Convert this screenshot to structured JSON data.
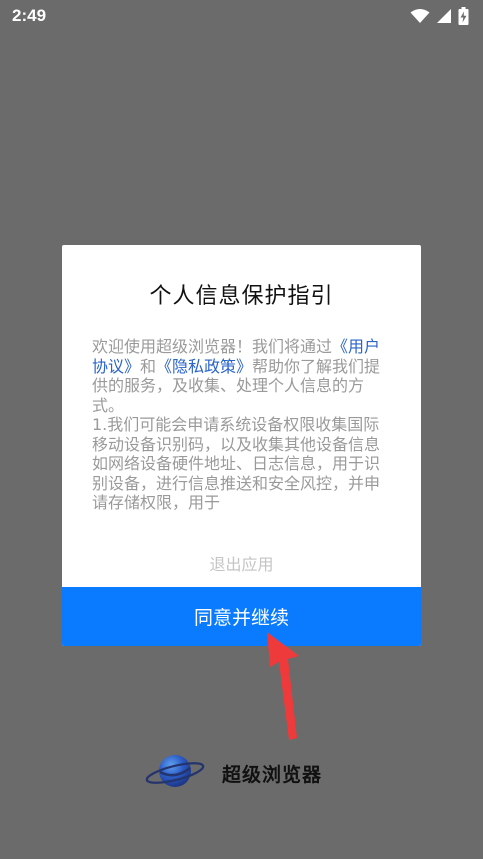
{
  "status_bar": {
    "time": "2:49",
    "icons": [
      "wifi-icon",
      "signal-icon",
      "battery-charging-icon"
    ]
  },
  "dialog": {
    "title": "个人信息保护指引",
    "paragraph1": {
      "prefix": "欢迎使用超级浏览器！我们将通过",
      "link_user_agreement": "《用户协议》",
      "middle": "和",
      "link_privacy_policy": "《隐私政策》",
      "suffix": "帮助你了解我们提供的服务，及收集、处理个人信息的方式。"
    },
    "paragraph2": "1.我们可能会申请系统设备权限收集国际移动设备识别码，以及收集其他设备信息如网络设备硬件地址、日志信息，用于识别设备，进行信息推送和安全风控，并申请存储权限，用于",
    "exit_label": "退出应用",
    "agree_label": "同意并继续"
  },
  "brand": {
    "name": "超级浏览器",
    "icon": "planet-icon"
  },
  "colors": {
    "overlay": "#6b6b6b",
    "accent": "#0a7bff",
    "link": "#2a63c9",
    "arrow": "#ee3a3a"
  }
}
